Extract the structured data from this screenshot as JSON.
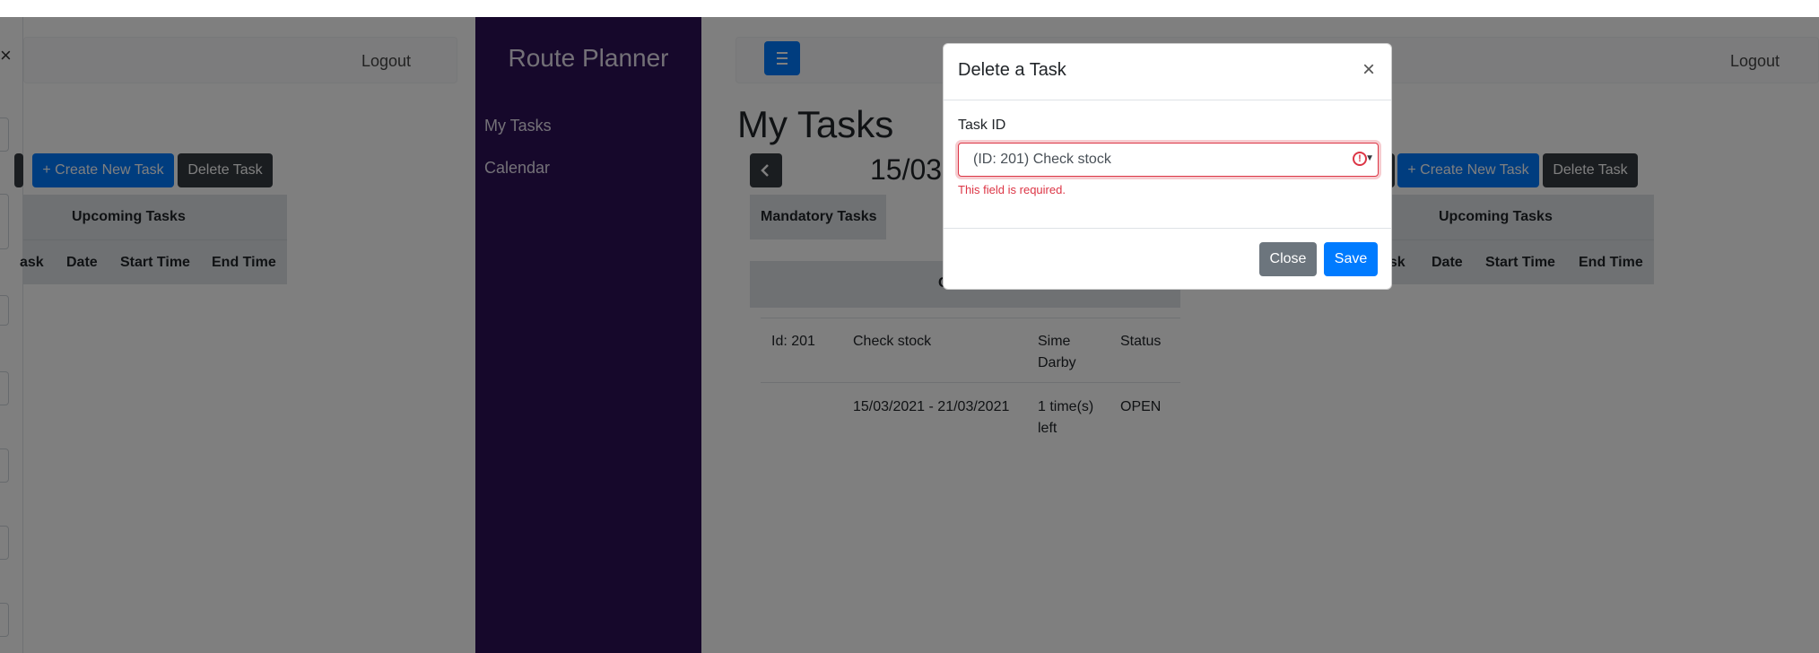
{
  "left_panel": {
    "close_symbol": "×",
    "logout": "Logout",
    "create_button": "+ Create New Task",
    "delete_button": "Delete Task",
    "upcoming_header": "Upcoming Tasks",
    "columns": [
      "ask",
      "Date",
      "Start Time",
      "End Time"
    ]
  },
  "sidebar": {
    "brand": "Route Planner",
    "items": [
      {
        "label": "My Tasks"
      },
      {
        "label": "Calendar"
      }
    ]
  },
  "main": {
    "logout": "Logout",
    "page_title": "My Tasks",
    "date_title": "15/03",
    "mandatory_tab": "Mandatory Tasks",
    "customer_header": "Cus",
    "create_button": "+ Create New Task",
    "delete_button": "Delete Task",
    "upcoming_header": "Upcoming Tasks",
    "columns": [
      "ask",
      "Date",
      "Start Time",
      "End Time"
    ],
    "task": {
      "id": "Id: 201",
      "name": "Check stock",
      "customer": "Sime Darby",
      "status_label": "Status",
      "date_range": "15/03/2021 - 21/03/2021",
      "times_left": "1 time(s) left",
      "status": "OPEN"
    }
  },
  "modal": {
    "title": "Delete a Task",
    "close_symbol": "×",
    "field_label": "Task ID",
    "selected_option": "(ID: 201) Check stock",
    "error": "This field is required.",
    "close_button": "Close",
    "save_button": "Save"
  },
  "colors": {
    "sidebar": "#2d1156",
    "primary": "#007bff",
    "dark": "#343a40",
    "danger": "#dc3545"
  }
}
